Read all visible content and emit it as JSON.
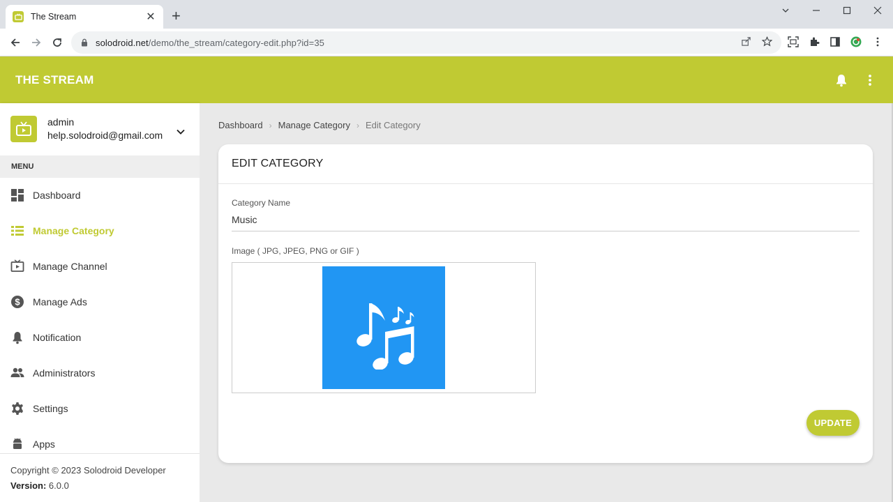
{
  "browser": {
    "tab_title": "The Stream",
    "url_host": "solodroid.net",
    "url_path": "/demo/the_stream/category-edit.php?id=35"
  },
  "app": {
    "brand": "THE STREAM"
  },
  "sidebar": {
    "user_name": "admin",
    "user_email": "help.solodroid@gmail.com",
    "menu_header": "MENU",
    "items": [
      {
        "label": "Dashboard",
        "icon": "dashboard-icon"
      },
      {
        "label": "Manage Category",
        "icon": "list-icon",
        "active": true
      },
      {
        "label": "Manage Channel",
        "icon": "tv-icon"
      },
      {
        "label": "Manage Ads",
        "icon": "dollar-icon"
      },
      {
        "label": "Notification",
        "icon": "bell-icon"
      },
      {
        "label": "Administrators",
        "icon": "people-icon"
      },
      {
        "label": "Settings",
        "icon": "gear-icon"
      },
      {
        "label": "Apps",
        "icon": "android-icon"
      }
    ],
    "copyright": "Copyright © 2023 Solodroid Developer",
    "version_label": "Version:",
    "version_value": " 6.0.0"
  },
  "breadcrumb": {
    "items": [
      "Dashboard",
      "Manage Category",
      "Edit Category"
    ]
  },
  "form": {
    "title": "EDIT CATEGORY",
    "name_label": "Category Name",
    "name_value": "Music",
    "image_label": "Image ( JPG, JPEG, PNG or GIF )",
    "submit_label": "UPDATE"
  },
  "colors": {
    "accent": "#c0ca33",
    "image_bg": "#2196f3"
  }
}
